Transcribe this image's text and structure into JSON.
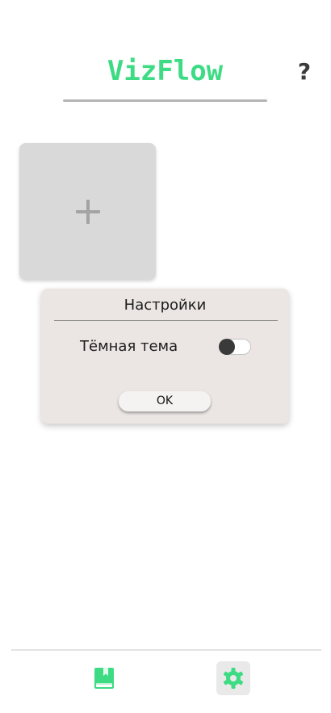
{
  "header": {
    "app_title": "VizFlow",
    "help_label": "?"
  },
  "main": {
    "add_card": {
      "icon": "plus-icon"
    }
  },
  "dialog": {
    "title": "Настройки",
    "dark_theme": {
      "label": "Тёмная тема",
      "enabled": false
    },
    "ok_label": "OK"
  },
  "bottom_nav": {
    "items": [
      {
        "icon": "book-icon",
        "active": false
      },
      {
        "icon": "gear-icon",
        "active": true
      }
    ]
  },
  "colors": {
    "accent": "#3ddc84",
    "dialog_bg": "#ebe6e4",
    "card_bg": "#d9d9d9"
  }
}
